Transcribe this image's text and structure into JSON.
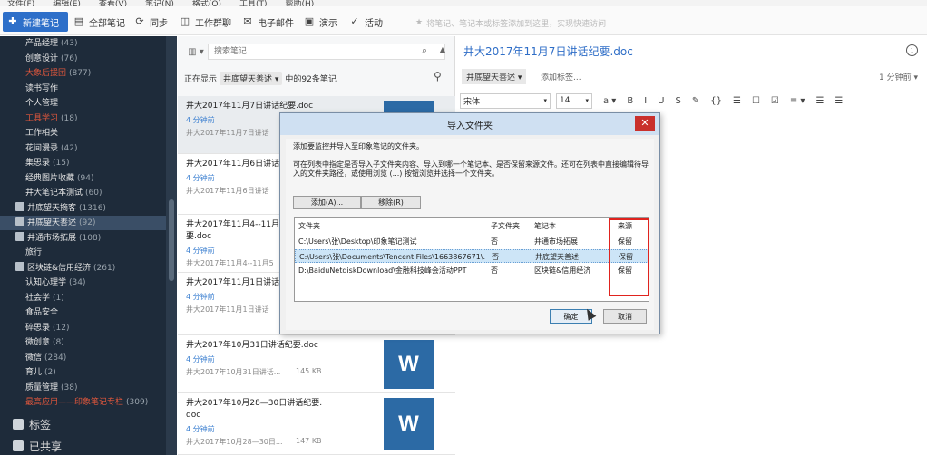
{
  "menubar": [
    "文件(F)",
    "编辑(E)",
    "查看(V)",
    "笔记(N)",
    "格式(O)",
    "工具(T)",
    "帮助(H)"
  ],
  "toolbar": {
    "new_note": "新建笔记",
    "all_notes": "全部笔记",
    "sync": "同步",
    "work_chat": "工作群聊",
    "email": "电子邮件",
    "demo": "演示",
    "activity": "活动",
    "search_hint": "将笔记、笔记本或标签添加到这里，实现快速访问"
  },
  "sidebar": {
    "items": [
      {
        "label": "产品经理",
        "count": "(43)"
      },
      {
        "label": "创意设计",
        "count": "(76)"
      },
      {
        "label": "大象后援团",
        "count": "(877)",
        "red": true
      },
      {
        "label": "读书写作",
        "count": ""
      },
      {
        "label": "个人管理",
        "count": ""
      },
      {
        "label": "工具学习",
        "count": "(18)",
        "red": true
      },
      {
        "label": "工作相关",
        "count": ""
      },
      {
        "label": "花间漫录",
        "count": "(42)"
      },
      {
        "label": "集思录",
        "count": "(15)"
      },
      {
        "label": "经典图片收藏",
        "count": "(94)"
      },
      {
        "label": "井大笔记本测试",
        "count": "(60)"
      },
      {
        "label": "井底望天摘客",
        "count": "(1316)",
        "stack": true
      },
      {
        "label": "井底望天善述",
        "count": "(92)",
        "stack": true,
        "selected": true
      },
      {
        "label": "井通市场拓展",
        "count": "(108)",
        "stack": true
      },
      {
        "label": "旅行",
        "count": ""
      },
      {
        "label": "区块链&信用经济",
        "count": "(261)",
        "stack": true
      },
      {
        "label": "认知心理学",
        "count": "(34)"
      },
      {
        "label": "社会学",
        "count": "(1)"
      },
      {
        "label": "食品安全",
        "count": ""
      },
      {
        "label": "碎思录",
        "count": "(12)"
      },
      {
        "label": "微创意",
        "count": "(8)"
      },
      {
        "label": "微信",
        "count": "(284)"
      },
      {
        "label": "育儿",
        "count": "(2)"
      },
      {
        "label": "质量管理",
        "count": "(38)"
      },
      {
        "label": "最高应用——印象笔记专栏",
        "count": "(309)",
        "red": true
      }
    ],
    "tags_label": "标签",
    "shared_label": "已共享"
  },
  "notelist": {
    "search_placeholder": "搜索笔记",
    "showing_label": "正在显示",
    "notebook_filter": "井底望天善述 ▾",
    "count_text": "中的92条笔记",
    "notes": [
      {
        "title": "井大2017年11月7日讲话纪要.doc",
        "time": "4 分钟前",
        "snippet": "井大2017年11月7日讲话",
        "size": "",
        "selected": true
      },
      {
        "title": "井大2017年11月6日讲话",
        "time": "4 分钟前",
        "snippet": "井大2017年11月6日讲话",
        "size": ""
      },
      {
        "title": "井大2017年11月4--11月5",
        "title2": "要.doc",
        "time": "4 分钟前",
        "snippet": "井大2017年11月4--11月5",
        "size": ""
      },
      {
        "title": "井大2017年11月1日讲话",
        "time": "4 分钟前",
        "snippet": "井大2017年11月1日讲话",
        "size": ""
      },
      {
        "title": "井大2017年10月31日讲话纪要.doc",
        "time": "4 分钟前",
        "snippet": "井大2017年10月31日讲话...",
        "size": "145 KB",
        "icon": "W"
      },
      {
        "title": "井大2017年10月28—30日讲话纪要.",
        "title2": "doc",
        "time": "4 分钟前",
        "snippet": "井大2017年10月28—30日...",
        "size": "147 KB",
        "icon": "W"
      }
    ]
  },
  "editor": {
    "title": "井大2017年11月7日讲话纪要.doc",
    "notebook": "井底望天善述 ▾",
    "add_tag": "添加标签...",
    "time": "1 分钟前 ▾",
    "font": "宋体",
    "font_size": "14",
    "fmt_buttons": [
      "a ▾",
      "B",
      "I",
      "U",
      "S",
      "✎",
      "{}",
      "☰",
      "☐",
      "☑",
      "≡ ▾",
      "☰",
      "☰"
    ]
  },
  "dialog": {
    "title": "导入文件夹",
    "desc1": "添加要监控并导入至印象笔记的文件夹。",
    "desc2": "可在列表中指定是否导入子文件夹内容、导入到哪一个笔记本、是否保留来源文件。还可在列表中直接编辑待导入的文件夹路径，或使用浏览 (...) 按钮浏览并选择一个文件夹。",
    "add_button": "添加(A)...",
    "remove_button": "移除(R)",
    "columns": [
      "文件夹",
      "子文件夹",
      "笔记本",
      "来源"
    ],
    "rows": [
      {
        "folder": "C:\\Users\\张\\Desktop\\印象笔记测试",
        "subfolder": "否",
        "notebook": "井通市场拓展",
        "source": "保留"
      },
      {
        "folder": "C:\\Users\\张\\Documents\\Tencent Files\\1663867671\\...",
        "subfolder": "否",
        "notebook": "井底望天善述",
        "source": "保留",
        "selected": true
      },
      {
        "folder": "D:\\BaiduNetdiskDownload\\金融科技峰会活动PPT",
        "subfolder": "否",
        "notebook": "区块链&信用经济",
        "source": "保留"
      }
    ],
    "ok_button": "确定",
    "cancel_button": "取消",
    "close_glyph": "✕"
  }
}
